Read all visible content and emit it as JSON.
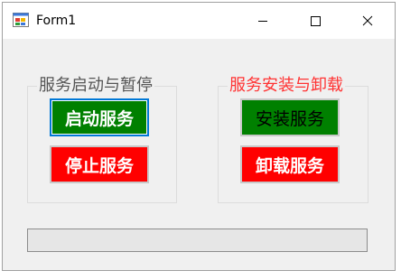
{
  "window": {
    "title": "Form1",
    "icon": "winforms-app-icon",
    "controls": [
      "minimize-icon",
      "maximize-icon",
      "close-icon"
    ]
  },
  "groups": {
    "start_stop": {
      "title": "服务启动与暂停",
      "start_label": "启动服务",
      "stop_label": "停止服务"
    },
    "install_uninstall": {
      "title": "服务安装与卸载",
      "install_label": "安装服务",
      "uninstall_label": "卸载服务"
    }
  },
  "progress": {
    "value": 0
  },
  "colors": {
    "green_button": "#008000",
    "red_button": "#ff0000",
    "group_title_left": "#555555",
    "group_title_right": "#ff3333",
    "focus_border": "#0078d7"
  }
}
